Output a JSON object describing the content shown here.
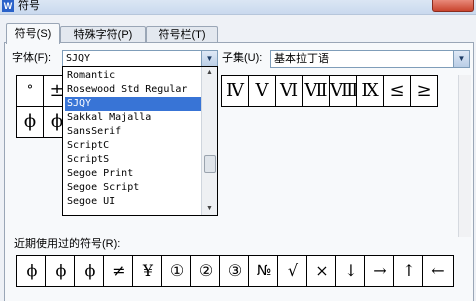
{
  "window": {
    "title": "符号",
    "icon": "wps-w-icon"
  },
  "tabs": [
    "符号(S)",
    "特殊字符(P)",
    "符号栏(T)"
  ],
  "font": {
    "label": "字体(F):",
    "value": "SJQY"
  },
  "subset": {
    "label": "子集(U):",
    "value": "基本拉丁语"
  },
  "font_list": {
    "items": [
      "Romantic",
      "Rosewood Std Regular",
      "SJQY",
      "Sakkal Majalla",
      "SansSerif",
      "ScriptC",
      "ScriptS",
      "Segoe Print",
      "Segoe Script",
      "Segoe UI"
    ],
    "selected": "SJQY"
  },
  "symbol_grid": {
    "row1_left": [
      "°",
      "±"
    ],
    "row1_right": [
      "Ⅳ",
      "Ⅴ",
      "Ⅵ",
      "Ⅶ",
      "Ⅷ",
      "Ⅸ",
      "≤",
      "≥"
    ],
    "row2_left": [
      "ϕ",
      "ϕ"
    ]
  },
  "recent": {
    "label": "近期使用过的符号(R):",
    "symbols": [
      "ϕ",
      "ϕ",
      "ϕ",
      "≠",
      "¥",
      "①",
      "②",
      "③",
      "№",
      "√",
      "×",
      "↓",
      "→",
      "↑",
      "←"
    ]
  }
}
